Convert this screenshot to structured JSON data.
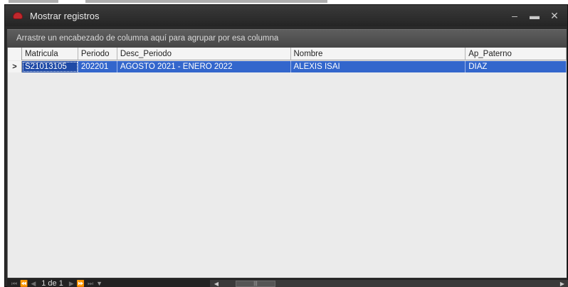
{
  "window": {
    "title": "Mostrar registros",
    "minimize_icon": "minimize-icon",
    "maximize_icon": "maximize-icon",
    "close_icon": "close-icon"
  },
  "group_panel": {
    "text": "Arrastre un encabezado de columna aquí para agrupar por esa columna"
  },
  "grid": {
    "columns": [
      "Matricula",
      "Periodo",
      "Desc_Periodo",
      "Nombre",
      "Ap_Paterno"
    ],
    "rows": [
      {
        "indicator": ">",
        "cells": [
          "S21013105",
          "202201",
          "AGOSTO 2021 - ENERO 2022",
          "ALEXIS ISAI",
          "DIAZ"
        ]
      }
    ],
    "selected_row_color": "#3366cc"
  },
  "navigator": {
    "page_text": "1 de 1"
  }
}
